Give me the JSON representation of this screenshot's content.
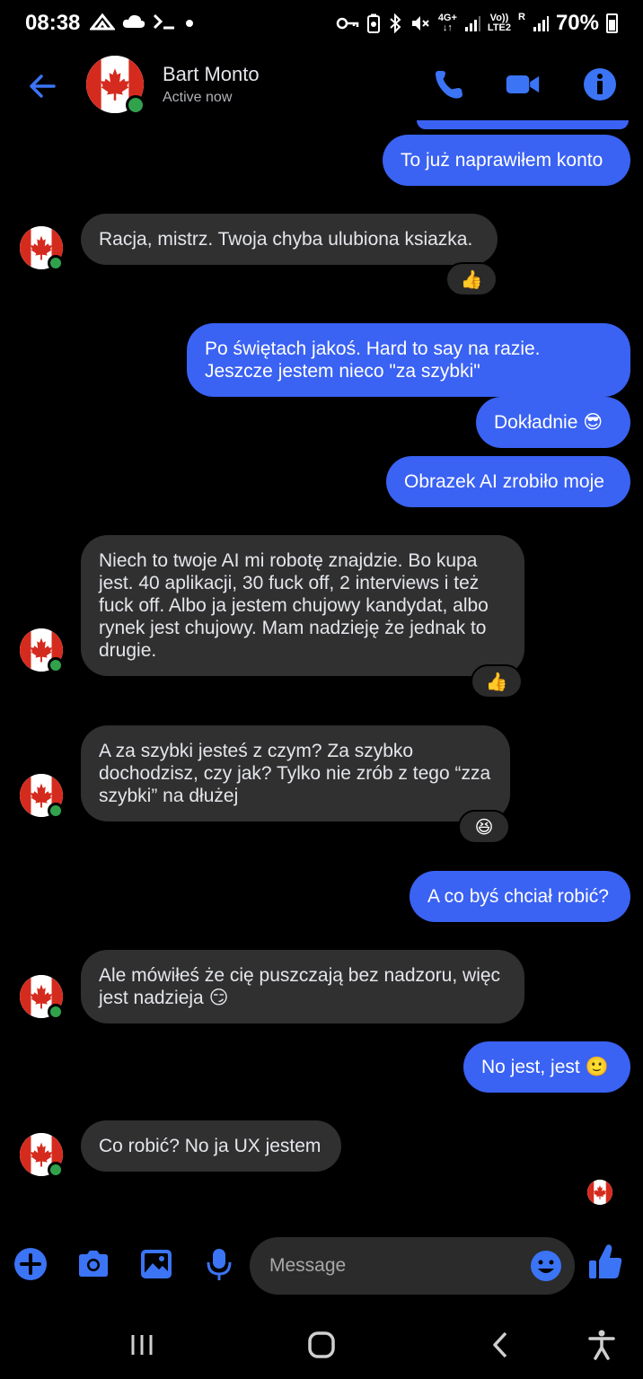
{
  "status_bar": {
    "time": "08:38",
    "network_top": "4G+",
    "volte_top": "Vo))",
    "volte_bottom": "LTE2",
    "roaming": "R",
    "battery": "70%"
  },
  "header": {
    "contact_name": "Bart Monto",
    "contact_status": "Active now"
  },
  "colors": {
    "accent": "#3a62f3",
    "incoming_bubble": "#303030",
    "background": "#000000",
    "online": "#31a24c"
  },
  "messages": [
    {
      "dir": "out",
      "text": "To już naprawiłem konto"
    },
    {
      "dir": "in",
      "text": "Racja, mistrz. Twoja chyba ulubiona ksiazka.",
      "reaction": "👍"
    },
    {
      "dir": "out",
      "text": "Po świętach jakoś. Hard to say na razie. Jeszcze jestem nieco \"za szybki\""
    },
    {
      "dir": "out",
      "text": "Dokładnie 😎"
    },
    {
      "dir": "out",
      "text": "Obrazek AI zrobiło moje"
    },
    {
      "dir": "in",
      "text": "Niech to twoje AI mi robotę znajdzie. Bo kupa jest. 40 aplikacji, 30 fuck off, 2 interviews i też fuck off. Albo ja jestem chujowy kandydat, albo rynek jest chujowy. Mam nadzieję że jednak to drugie.",
      "reaction": "👍"
    },
    {
      "dir": "in",
      "text": "A za szybki jesteś z czym? Za szybko dochodzisz, czy jak? Tylko nie zrób z tego “zza szybki” na dłużej",
      "reaction": "😆"
    },
    {
      "dir": "out",
      "text": "A co byś chciał robić?"
    },
    {
      "dir": "in",
      "text": "Ale mówiłeś że cię puszczają bez nadzoru, więc jest nadzieja 😏"
    },
    {
      "dir": "out",
      "text": "No jest, jest 🙂"
    },
    {
      "dir": "in",
      "text": "Co robić? No ja UX jestem"
    }
  ],
  "composer": {
    "placeholder": "Message"
  },
  "icons": {
    "back": "arrow-left-icon",
    "call": "phone-icon",
    "video": "video-camera-icon",
    "info": "info-icon",
    "plus": "plus-circle-icon",
    "camera": "camera-icon",
    "gallery": "image-icon",
    "mic": "microphone-icon",
    "emoji": "emoji-icon",
    "like": "thumbs-up-icon"
  }
}
